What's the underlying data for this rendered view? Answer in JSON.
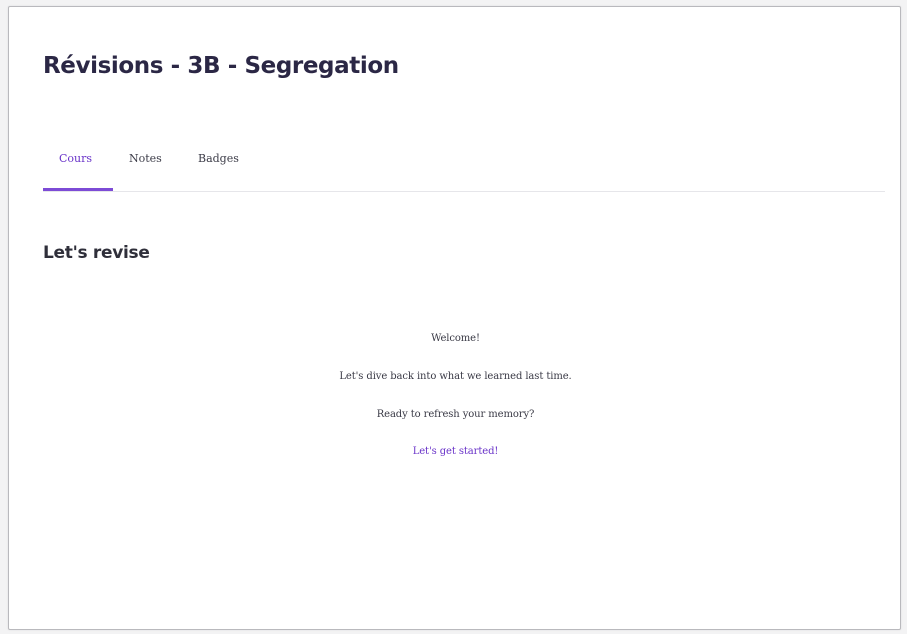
{
  "header": {
    "title": "Révisions - 3B - Segregation"
  },
  "tabs": [
    {
      "label": "Cours",
      "active": true
    },
    {
      "label": "Notes",
      "active": false
    },
    {
      "label": "Badges",
      "active": false
    }
  ],
  "main": {
    "section_title": "Let's revise",
    "messages": [
      "Welcome!",
      "Let's dive back into what we learned last time.",
      "Ready to refresh your memory?"
    ],
    "cta_label": "Let's get started!"
  },
  "colors": {
    "accent": "#7d4bd6",
    "title": "#2b2745",
    "background": "#ffffff"
  }
}
